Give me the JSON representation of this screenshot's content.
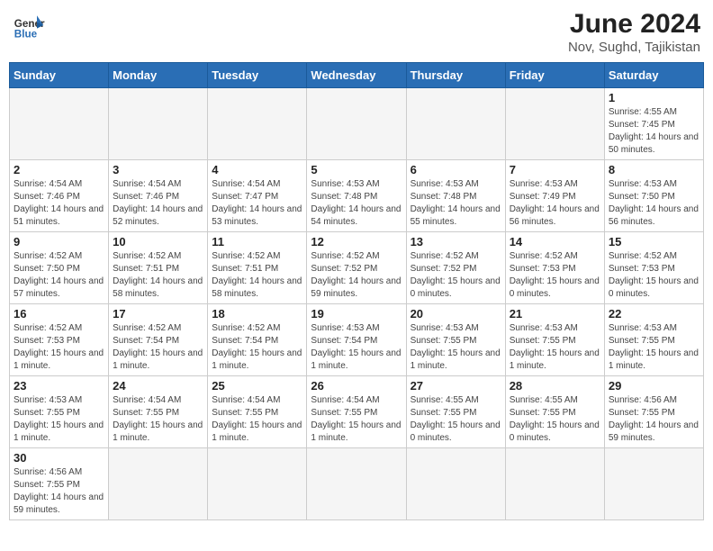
{
  "header": {
    "logo_general": "General",
    "logo_blue": "Blue",
    "title": "June 2024",
    "subtitle": "Nov, Sughd, Tajikistan"
  },
  "days_of_week": [
    "Sunday",
    "Monday",
    "Tuesday",
    "Wednesday",
    "Thursday",
    "Friday",
    "Saturday"
  ],
  "weeks": [
    [
      {
        "day": "",
        "info": ""
      },
      {
        "day": "",
        "info": ""
      },
      {
        "day": "",
        "info": ""
      },
      {
        "day": "",
        "info": ""
      },
      {
        "day": "",
        "info": ""
      },
      {
        "day": "",
        "info": ""
      },
      {
        "day": "1",
        "info": "Sunrise: 4:55 AM\nSunset: 7:45 PM\nDaylight: 14 hours and 50 minutes."
      }
    ],
    [
      {
        "day": "2",
        "info": "Sunrise: 4:54 AM\nSunset: 7:46 PM\nDaylight: 14 hours and 51 minutes."
      },
      {
        "day": "3",
        "info": "Sunrise: 4:54 AM\nSunset: 7:46 PM\nDaylight: 14 hours and 52 minutes."
      },
      {
        "day": "4",
        "info": "Sunrise: 4:54 AM\nSunset: 7:47 PM\nDaylight: 14 hours and 53 minutes."
      },
      {
        "day": "5",
        "info": "Sunrise: 4:53 AM\nSunset: 7:48 PM\nDaylight: 14 hours and 54 minutes."
      },
      {
        "day": "6",
        "info": "Sunrise: 4:53 AM\nSunset: 7:48 PM\nDaylight: 14 hours and 55 minutes."
      },
      {
        "day": "7",
        "info": "Sunrise: 4:53 AM\nSunset: 7:49 PM\nDaylight: 14 hours and 56 minutes."
      },
      {
        "day": "8",
        "info": "Sunrise: 4:53 AM\nSunset: 7:50 PM\nDaylight: 14 hours and 56 minutes."
      }
    ],
    [
      {
        "day": "9",
        "info": "Sunrise: 4:52 AM\nSunset: 7:50 PM\nDaylight: 14 hours and 57 minutes."
      },
      {
        "day": "10",
        "info": "Sunrise: 4:52 AM\nSunset: 7:51 PM\nDaylight: 14 hours and 58 minutes."
      },
      {
        "day": "11",
        "info": "Sunrise: 4:52 AM\nSunset: 7:51 PM\nDaylight: 14 hours and 58 minutes."
      },
      {
        "day": "12",
        "info": "Sunrise: 4:52 AM\nSunset: 7:52 PM\nDaylight: 14 hours and 59 minutes."
      },
      {
        "day": "13",
        "info": "Sunrise: 4:52 AM\nSunset: 7:52 PM\nDaylight: 15 hours and 0 minutes."
      },
      {
        "day": "14",
        "info": "Sunrise: 4:52 AM\nSunset: 7:53 PM\nDaylight: 15 hours and 0 minutes."
      },
      {
        "day": "15",
        "info": "Sunrise: 4:52 AM\nSunset: 7:53 PM\nDaylight: 15 hours and 0 minutes."
      }
    ],
    [
      {
        "day": "16",
        "info": "Sunrise: 4:52 AM\nSunset: 7:53 PM\nDaylight: 15 hours and 1 minute."
      },
      {
        "day": "17",
        "info": "Sunrise: 4:52 AM\nSunset: 7:54 PM\nDaylight: 15 hours and 1 minute."
      },
      {
        "day": "18",
        "info": "Sunrise: 4:52 AM\nSunset: 7:54 PM\nDaylight: 15 hours and 1 minute."
      },
      {
        "day": "19",
        "info": "Sunrise: 4:53 AM\nSunset: 7:54 PM\nDaylight: 15 hours and 1 minute."
      },
      {
        "day": "20",
        "info": "Sunrise: 4:53 AM\nSunset: 7:55 PM\nDaylight: 15 hours and 1 minute."
      },
      {
        "day": "21",
        "info": "Sunrise: 4:53 AM\nSunset: 7:55 PM\nDaylight: 15 hours and 1 minute."
      },
      {
        "day": "22",
        "info": "Sunrise: 4:53 AM\nSunset: 7:55 PM\nDaylight: 15 hours and 1 minute."
      }
    ],
    [
      {
        "day": "23",
        "info": "Sunrise: 4:53 AM\nSunset: 7:55 PM\nDaylight: 15 hours and 1 minute."
      },
      {
        "day": "24",
        "info": "Sunrise: 4:54 AM\nSunset: 7:55 PM\nDaylight: 15 hours and 1 minute."
      },
      {
        "day": "25",
        "info": "Sunrise: 4:54 AM\nSunset: 7:55 PM\nDaylight: 15 hours and 1 minute."
      },
      {
        "day": "26",
        "info": "Sunrise: 4:54 AM\nSunset: 7:55 PM\nDaylight: 15 hours and 1 minute."
      },
      {
        "day": "27",
        "info": "Sunrise: 4:55 AM\nSunset: 7:55 PM\nDaylight: 15 hours and 0 minutes."
      },
      {
        "day": "28",
        "info": "Sunrise: 4:55 AM\nSunset: 7:55 PM\nDaylight: 15 hours and 0 minutes."
      },
      {
        "day": "29",
        "info": "Sunrise: 4:56 AM\nSunset: 7:55 PM\nDaylight: 14 hours and 59 minutes."
      }
    ],
    [
      {
        "day": "30",
        "info": "Sunrise: 4:56 AM\nSunset: 7:55 PM\nDaylight: 14 hours and 59 minutes."
      },
      {
        "day": "",
        "info": ""
      },
      {
        "day": "",
        "info": ""
      },
      {
        "day": "",
        "info": ""
      },
      {
        "day": "",
        "info": ""
      },
      {
        "day": "",
        "info": ""
      },
      {
        "day": "",
        "info": ""
      }
    ]
  ]
}
